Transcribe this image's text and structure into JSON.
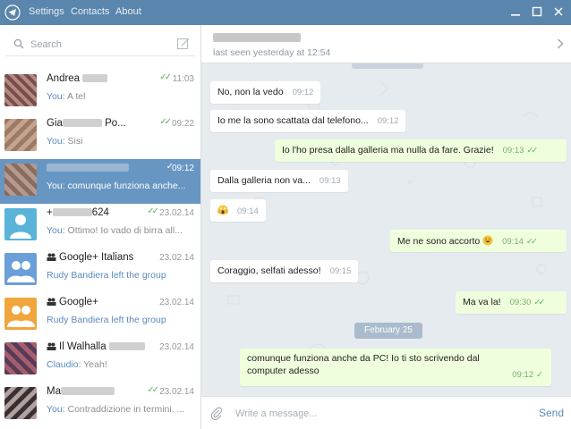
{
  "window": {
    "menu": [
      "Settings",
      "Contacts",
      "About"
    ],
    "accent": "#5a86ad"
  },
  "sidebar": {
    "search_placeholder": "Search",
    "chats": [
      {
        "name": "Andrea",
        "time": "11:03",
        "you": "You:",
        "preview": " A tel",
        "ticks": "✓✓",
        "avatar_color": "#8b5a5a"
      },
      {
        "name_prefix": "Gia",
        "name_suffix": " Po...",
        "time": "09:22",
        "you": "You:",
        "preview": " Sisi",
        "ticks": "✓✓",
        "avatar_color": "#a9806a"
      },
      {
        "name": "",
        "time": "09:12",
        "you": "You:",
        "preview": " comunque funziona anche...",
        "ticks": "✓",
        "avatar_color": "#9b7a6a"
      },
      {
        "name_prefix": "+",
        "name_suffix": "624",
        "time": "23.02.14",
        "you": "You:",
        "preview": " Ottimo! Io vado di birra all...",
        "ticks": "✓✓",
        "avatar_color": "#5ab3d9"
      },
      {
        "name": "Google+ Italians",
        "time": "23.02.14",
        "preview": "Rudy Bandiera left the group",
        "avatar_color": "#6a9fd9"
      },
      {
        "name": "Google+",
        "time": "23.02.14",
        "preview": "Rudy Bandiera left the group",
        "avatar_color": "#f0a63c"
      },
      {
        "name_prefix": "Il Walhalla",
        "time": "23.02.14",
        "you": "Claudio:",
        "preview": " Yeah!",
        "avatar_color": "#7a4a6a"
      },
      {
        "name_prefix": "Ma",
        "time": "23.02.14",
        "you": "You:",
        "preview": " Contraddizione in termini. ...",
        "ticks": "✓✓",
        "avatar_color": "#6a5a5a"
      }
    ]
  },
  "chat": {
    "status": "last seen yesterday at 12:54",
    "messages": [
      {
        "dir": "in",
        "text": "No, non la vedo",
        "time": "09:12"
      },
      {
        "dir": "in",
        "text": "Io me la sono scattata dal telefono...",
        "time": "09:12"
      },
      {
        "dir": "out",
        "text": "Io l'ho presa dalla galleria ma nulla da fare. Grazie!",
        "time": "09:13",
        "ticks": "✓✓"
      },
      {
        "dir": "in",
        "text": "Dalla galleria non va...",
        "time": "09:13"
      },
      {
        "dir": "in",
        "text": "",
        "emoji": "scream",
        "time": "09:14"
      },
      {
        "dir": "out",
        "text": "Me ne sono accorto",
        "emoji": "smile",
        "time": "09:14",
        "ticks": "✓✓"
      },
      {
        "dir": "in",
        "text": "Coraggio, selfati adesso!",
        "time": "09:15"
      },
      {
        "dir": "out",
        "text": "Ma va la!",
        "time": "09:30",
        "ticks": "✓✓"
      },
      {
        "dir": "out",
        "text": "comunque funziona anche da PC! Io ti sto scrivendo dal computer adesso",
        "time": "09:12",
        "ticks": "✓"
      }
    ],
    "date_divider": "February 25",
    "composer_placeholder": "Write a message...",
    "send_label": "Send"
  }
}
